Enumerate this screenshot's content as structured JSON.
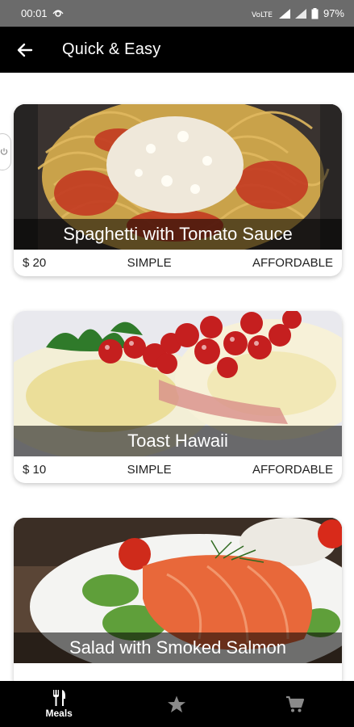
{
  "status_bar": {
    "time": "00:01",
    "battery": "97%",
    "icons": [
      "wifi-calling-icon",
      "volte-icon",
      "signal-icon",
      "battery-icon"
    ]
  },
  "app_bar": {
    "title": "Quick & Easy",
    "back_icon": "arrow-left-icon"
  },
  "meals": [
    {
      "title": "Spaghetti with Tomato Sauce",
      "price": "$ 20",
      "complexity": "SIMPLE",
      "affordability": "AFFORDABLE"
    },
    {
      "title": "Toast Hawaii",
      "price": "$ 10",
      "complexity": "SIMPLE",
      "affordability": "AFFORDABLE"
    },
    {
      "title": "Salad with Smoked Salmon",
      "price": "",
      "complexity": "",
      "affordability": ""
    }
  ],
  "bottom_nav": {
    "items": [
      {
        "label": "Meals",
        "icon": "restaurant-icon"
      },
      {
        "label": "",
        "icon": "star-icon"
      },
      {
        "label": "",
        "icon": "cart-icon"
      }
    ]
  },
  "colors": {
    "app_bar": "#000000",
    "status_bar": "#6b6b6b",
    "bottom_nav": "#000000"
  }
}
